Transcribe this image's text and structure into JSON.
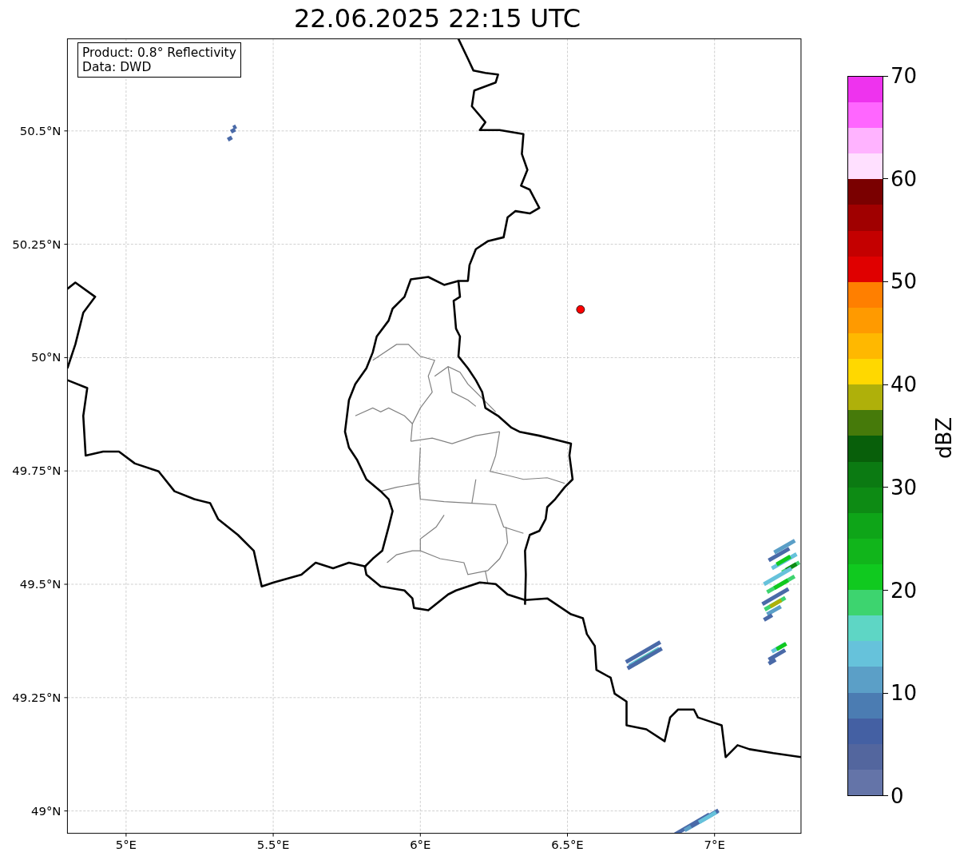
{
  "title": "22.06.2025 22:15 UTC",
  "info_box": {
    "lines": [
      "Product: 0.8° Reflectivity",
      "Data: DWD"
    ]
  },
  "map": {
    "lat_ticks": [
      "50.5°N",
      "50.25°N",
      "50°N",
      "49.75°N",
      "49.5°N",
      "49.25°N",
      "49°N"
    ],
    "lon_ticks": [
      "5°E",
      "5.5°E",
      "6°E",
      "6.5°E",
      "7°E"
    ]
  },
  "colorbar": {
    "label": "dBZ",
    "ticks": [
      "70",
      "60",
      "50",
      "40",
      "30",
      "20",
      "10",
      "0"
    ],
    "segments": [
      {
        "color": "#6474a8"
      },
      {
        "color": "#53669e"
      },
      {
        "color": "#4460a3"
      },
      {
        "color": "#4b7cb2"
      },
      {
        "color": "#5b9fc7"
      },
      {
        "color": "#66c2db"
      },
      {
        "color": "#5ed6c5"
      },
      {
        "color": "#3dd46f"
      },
      {
        "color": "#10c91f"
      },
      {
        "color": "#11b51b"
      },
      {
        "color": "#0ea518"
      },
      {
        "color": "#0d8b14"
      },
      {
        "color": "#0b7a12"
      },
      {
        "color": "#085f0a"
      },
      {
        "color": "#467a0a"
      },
      {
        "color": "#afb00a"
      },
      {
        "color": "#ffd800"
      },
      {
        "color": "#ffb800"
      },
      {
        "color": "#ff9a00"
      },
      {
        "color": "#ff7f00"
      },
      {
        "color": "#e00000"
      },
      {
        "color": "#c40000"
      },
      {
        "color": "#a00000"
      },
      {
        "color": "#7a0000"
      },
      {
        "color": "#ffe0ff"
      },
      {
        "color": "#ffb3ff"
      },
      {
        "color": "#ff66ff"
      },
      {
        "color": "#ee33ee"
      }
    ]
  }
}
